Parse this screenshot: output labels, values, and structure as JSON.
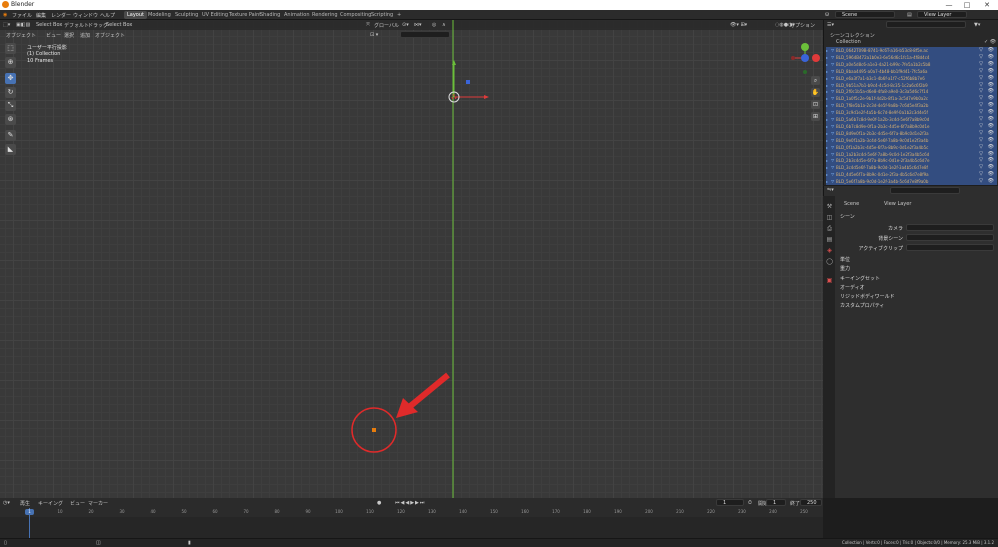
{
  "window": {
    "title": "Blender",
    "minimize": "—",
    "maximize": "□",
    "close": "✕"
  },
  "menu": [
    "ファイル",
    "編集",
    "レンダー",
    "ウィンドウ",
    "ヘルプ"
  ],
  "workspaces": [
    "Layout",
    "Modeling",
    "Sculpting",
    "UV Editing",
    "Texture Paint",
    "Shading",
    "Animation",
    "Rendering",
    "Compositing",
    "Scripting"
  ],
  "workspace_add": "+",
  "scene": {
    "label": "Scene",
    "view_layer": "View Layer"
  },
  "header": {
    "mode": "オブジェクト",
    "view": "ビュー",
    "select": "選択",
    "add": "追加",
    "object": "オブジェクト",
    "orientation": "デフォルト",
    "drag": "ドラッグ",
    "select_box": "Select Box",
    "global": "グローバル",
    "options": "オプション"
  },
  "viewport_overlay": {
    "view_name": "ユーザー平行投影",
    "collection": "(1) Collection",
    "frames": "10 Frames"
  },
  "outliner": {
    "title": "シーンコレクション",
    "collection": "Collection",
    "search_placeholder": "",
    "rows": [
      "BLD_0642T09B-8741-9c6T-a16-b53c8-8f5e.ac",
      "BLD_5964B472a1b0e3-6e56d6c1fc1a-4f8d4c4",
      "BLD_a0e5d8c6-a1e3-4a21-b99c-7fe5a1b2c5b8",
      "BLD_8baa4495-a0a7-4b48-bb1f9d41-7fc5a6a",
      "BLD_e6a3f7a1-b3c1-4b6f-a1f7-c52f6b8b7e6",
      "BLD_9b51a7b1-b9c4-4c5d-8c35-1c2a6c6f2b9",
      "BLD_2f0c1b5a-d6e8-4fa8-a9e0-3c3a5d6c7f14",
      "BLD_1a0f5c2e-9b1f-4d2b-8f1a-3c5d7e9b0a2c",
      "BLD_7f8e5b1a-2c3d-4e5f-9a8b-7c6d5e4f3a2b",
      "BLD_3c9d1e2f-4a5b-6c7d-8e9f-0a1b2c3d4e5f",
      "BLD_5a6b7c8d-9e0f-1a2b-3c4d-5e6f7a8b9c0d",
      "BLD_6b7c8d9e-0f1a-2b3c-4d5e-6f7a8b9c0d1e",
      "BLD_8d9e0f1a-2b3c-4d5e-6f7a-8b9c0d1e2f3a",
      "BLD_9e0f1a2b-3c4d-5e6f-7a8b-9c0d1e2f3a4b",
      "BLD_0f1a2b3c-4d5e-6f7a-8b9c-0d1e2f3a4b5c",
      "BLD_1a2b3c4d-5e6f-7a8b-9c0d-1e2f3a4b5c6d",
      "BLD_2b3c4d5e-6f7a-8b9c-0d1e-2f3a4b5c6d7e",
      "BLD_3c4d5e6f-7a8b-9c0d-1e2f-3a4b5c6d7e8f",
      "BLD_4d5e6f7a-8b9c-0d1e-2f3a-4b5c6d7e8f9a",
      "BLD_5e6f7a8b-9c0d-1e2f-3a4b-5c6d7e8f9a0b"
    ]
  },
  "properties": {
    "tab_scene": "Scene",
    "tab_view_layer": "View Layer",
    "section": "シーン",
    "camera_label": "カメラ",
    "bg_scene_label": "背景シーン",
    "active_clip_label": "アクティブクリップ",
    "panels": [
      "単位",
      "重力",
      "キーイングセット",
      "オーディオ",
      "リジッドボディワールド",
      "カスタムプロパティ"
    ]
  },
  "timeline": {
    "menu": [
      "再生",
      "キーイング",
      "ビュー",
      "マーカー"
    ],
    "current_frame": "1",
    "start_label": "開始",
    "start": "1",
    "end_label": "終了",
    "end": "250",
    "ticks": [
      "0",
      "10",
      "20",
      "30",
      "40",
      "50",
      "60",
      "70",
      "80",
      "90",
      "100",
      "110",
      "120",
      "130",
      "140",
      "150",
      "160",
      "170",
      "180",
      "190",
      "200",
      "210",
      "220",
      "230",
      "240",
      "250"
    ]
  },
  "status": {
    "right": "Collection | Verts:0 | Faces:0 | Tris:0 | Objects:0/0 | Memory: 25.3 MiB | 3.1.2"
  },
  "accent": {
    "blue": "#4772b3",
    "orange": "#e87d0d",
    "red": "#e02a2a",
    "green": "#6bbf3a"
  }
}
